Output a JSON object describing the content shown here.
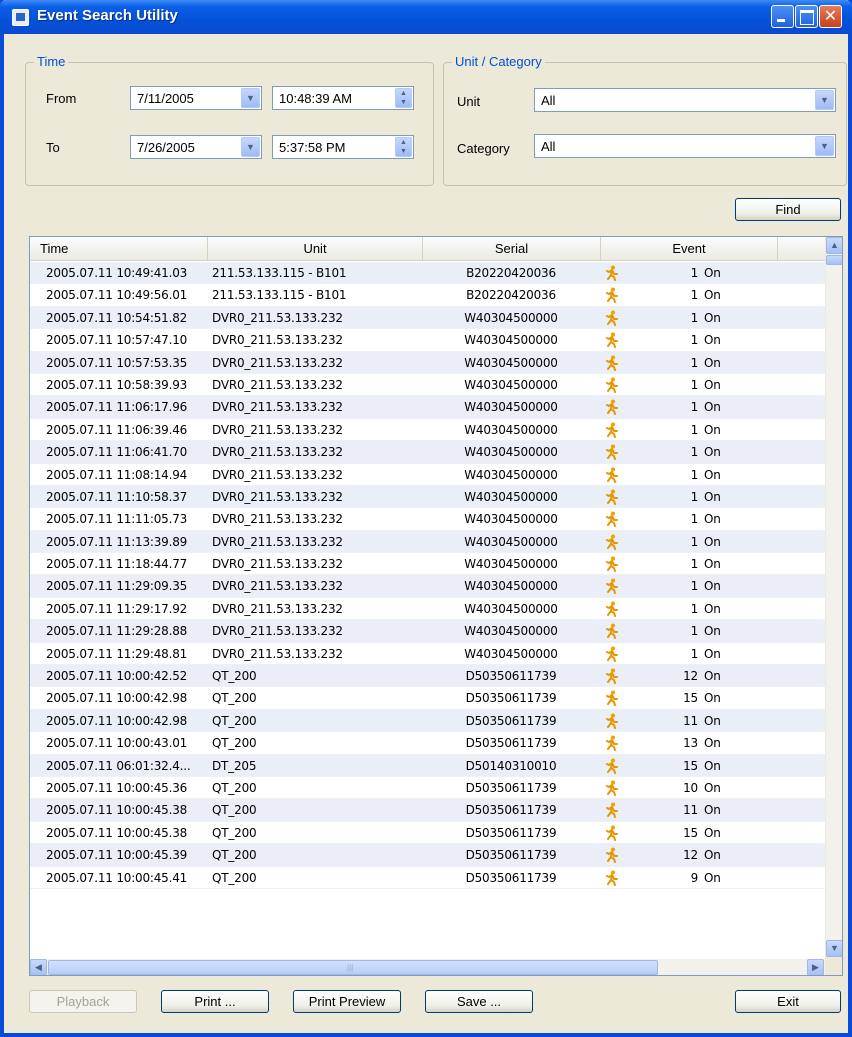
{
  "window": {
    "title": "Event Search Utility"
  },
  "time_group": {
    "legend": "Time",
    "from_label": "From",
    "from_date": "7/11/2005",
    "from_time": "10:48:39 AM",
    "to_label": "To",
    "to_date": "7/26/2005",
    "to_time": "5:37:58 PM"
  },
  "unit_group": {
    "legend": "Unit / Category",
    "unit_label": "Unit",
    "unit_value": "All",
    "category_label": "Category",
    "category_value": "All"
  },
  "buttons": {
    "find": "Find",
    "playback": "Playback",
    "print": "Print ...",
    "print_preview": "Print Preview",
    "save": "Save ...",
    "exit": "Exit"
  },
  "grid": {
    "columns": {
      "time": "Time",
      "unit": "Unit",
      "serial": "Serial",
      "event": "Event"
    },
    "rows": [
      {
        "time": "2005.07.11 10:49:41.03",
        "unit": "211.53.133.115 - B101",
        "serial": "B20220420036",
        "event": "1 On"
      },
      {
        "time": "2005.07.11 10:49:56.01",
        "unit": "211.53.133.115 - B101",
        "serial": "B20220420036",
        "event": "1 On"
      },
      {
        "time": "2005.07.11 10:54:51.82",
        "unit": "DVR0_211.53.133.232",
        "serial": "W40304500000",
        "event": "1 On"
      },
      {
        "time": "2005.07.11 10:57:47.10",
        "unit": "DVR0_211.53.133.232",
        "serial": "W40304500000",
        "event": "1 On"
      },
      {
        "time": "2005.07.11 10:57:53.35",
        "unit": "DVR0_211.53.133.232",
        "serial": "W40304500000",
        "event": "1 On"
      },
      {
        "time": "2005.07.11 10:58:39.93",
        "unit": "DVR0_211.53.133.232",
        "serial": "W40304500000",
        "event": "1 On"
      },
      {
        "time": "2005.07.11 11:06:17.96",
        "unit": "DVR0_211.53.133.232",
        "serial": "W40304500000",
        "event": "1 On"
      },
      {
        "time": "2005.07.11 11:06:39.46",
        "unit": "DVR0_211.53.133.232",
        "serial": "W40304500000",
        "event": "1 On"
      },
      {
        "time": "2005.07.11 11:06:41.70",
        "unit": "DVR0_211.53.133.232",
        "serial": "W40304500000",
        "event": "1 On"
      },
      {
        "time": "2005.07.11 11:08:14.94",
        "unit": "DVR0_211.53.133.232",
        "serial": "W40304500000",
        "event": "1 On"
      },
      {
        "time": "2005.07.11 11:10:58.37",
        "unit": "DVR0_211.53.133.232",
        "serial": "W40304500000",
        "event": "1 On"
      },
      {
        "time": "2005.07.11 11:11:05.73",
        "unit": "DVR0_211.53.133.232",
        "serial": "W40304500000",
        "event": "1 On"
      },
      {
        "time": "2005.07.11 11:13:39.89",
        "unit": "DVR0_211.53.133.232",
        "serial": "W40304500000",
        "event": "1 On"
      },
      {
        "time": "2005.07.11 11:18:44.77",
        "unit": "DVR0_211.53.133.232",
        "serial": "W40304500000",
        "event": "1 On"
      },
      {
        "time": "2005.07.11 11:29:09.35",
        "unit": "DVR0_211.53.133.232",
        "serial": "W40304500000",
        "event": "1 On"
      },
      {
        "time": "2005.07.11 11:29:17.92",
        "unit": "DVR0_211.53.133.232",
        "serial": "W40304500000",
        "event": "1 On"
      },
      {
        "time": "2005.07.11 11:29:28.88",
        "unit": "DVR0_211.53.133.232",
        "serial": "W40304500000",
        "event": "1 On"
      },
      {
        "time": "2005.07.11 11:29:48.81",
        "unit": "DVR0_211.53.133.232",
        "serial": "W40304500000",
        "event": "1 On"
      },
      {
        "time": "2005.07.11 10:00:42.52",
        "unit": "QT_200",
        "serial": "D50350611739",
        "event": "12 On"
      },
      {
        "time": "2005.07.11 10:00:42.98",
        "unit": "QT_200",
        "serial": "D50350611739",
        "event": "15 On"
      },
      {
        "time": "2005.07.11 10:00:42.98",
        "unit": "QT_200",
        "serial": "D50350611739",
        "event": "11 On"
      },
      {
        "time": "2005.07.11 10:00:43.01",
        "unit": "QT_200",
        "serial": "D50350611739",
        "event": "13 On"
      },
      {
        "time": "2005.07.11 06:01:32.4...",
        "unit": "DT_205",
        "serial": "D50140310010",
        "event": "15 On"
      },
      {
        "time": "2005.07.11 10:00:45.36",
        "unit": "QT_200",
        "serial": "D50350611739",
        "event": "10 On"
      },
      {
        "time": "2005.07.11 10:00:45.38",
        "unit": "QT_200",
        "serial": "D50350611739",
        "event": "11 On"
      },
      {
        "time": "2005.07.11 10:00:45.38",
        "unit": "QT_200",
        "serial": "D50350611739",
        "event": "15 On"
      },
      {
        "time": "2005.07.11 10:00:45.39",
        "unit": "QT_200",
        "serial": "D50350611739",
        "event": "12 On"
      },
      {
        "time": "2005.07.11 10:00:45.41",
        "unit": "QT_200",
        "serial": "D50350611739",
        "event": "9 On"
      }
    ]
  },
  "icons": {
    "app": "app-icon",
    "event": "running-man-icon",
    "dropdown": "chevron-down-icon",
    "spinner": "spinner-icon"
  },
  "colors": {
    "title_bar": "#0451d8",
    "group_legend": "#0050d0",
    "row_alt": "#e9eef7",
    "event_icon": "#f0a000"
  }
}
